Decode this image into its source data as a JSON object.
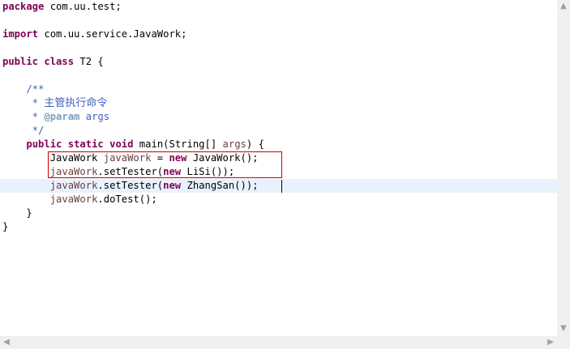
{
  "editor": {
    "lines": [
      [
        {
          "t": "package",
          "c": "kw"
        },
        {
          "t": " com.uu.test;",
          "c": ""
        }
      ],
      [],
      [
        {
          "t": "import",
          "c": "kw"
        },
        {
          "t": " com.uu.service.JavaWork;",
          "c": ""
        }
      ],
      [],
      [
        {
          "t": "public",
          "c": "kw"
        },
        {
          "t": " ",
          "c": ""
        },
        {
          "t": "class",
          "c": "kw"
        },
        {
          "t": " T2 {",
          "c": ""
        }
      ],
      [],
      [
        {
          "t": "    /**",
          "c": "cm"
        }
      ],
      [
        {
          "t": "     * ",
          "c": "cm"
        },
        {
          "t": "主管执行命令",
          "c": "cn"
        }
      ],
      [
        {
          "t": "     * ",
          "c": "cm"
        },
        {
          "t": "@param",
          "c": "tag"
        },
        {
          "t": " args",
          "c": "cm"
        }
      ],
      [
        {
          "t": "     */",
          "c": "cm"
        }
      ],
      [
        {
          "t": "    ",
          "c": ""
        },
        {
          "t": "public",
          "c": "kw"
        },
        {
          "t": " ",
          "c": ""
        },
        {
          "t": "static",
          "c": "kw"
        },
        {
          "t": " ",
          "c": ""
        },
        {
          "t": "void",
          "c": "kw"
        },
        {
          "t": " main(String[] ",
          "c": ""
        },
        {
          "t": "args",
          "c": "var"
        },
        {
          "t": ") {",
          "c": ""
        }
      ],
      [
        {
          "t": "        JavaWork ",
          "c": ""
        },
        {
          "t": "javaWork",
          "c": "var"
        },
        {
          "t": " = ",
          "c": ""
        },
        {
          "t": "new",
          "c": "kw"
        },
        {
          "t": " JavaWork();",
          "c": ""
        }
      ],
      [
        {
          "t": "        ",
          "c": ""
        },
        {
          "t": "javaWork",
          "c": "var"
        },
        {
          "t": ".setTester(",
          "c": ""
        },
        {
          "t": "new",
          "c": "kw"
        },
        {
          "t": " LiSi());",
          "c": ""
        }
      ],
      [
        {
          "t": "        ",
          "c": ""
        },
        {
          "t": "javaWork",
          "c": "var"
        },
        {
          "t": ".setTester(",
          "c": ""
        },
        {
          "t": "new",
          "c": "kw"
        },
        {
          "t": " ZhangSan());",
          "c": ""
        }
      ],
      [
        {
          "t": "        ",
          "c": ""
        },
        {
          "t": "javaWork",
          "c": "var"
        },
        {
          "t": ".doTest();",
          "c": ""
        }
      ],
      [
        {
          "t": "    }",
          "c": ""
        }
      ],
      [
        {
          "t": "}",
          "c": ""
        }
      ]
    ],
    "current_line_index": 13
  },
  "scrollbars": {
    "up_arrow": "▲",
    "down_arrow": "▼",
    "left_arrow": "◀",
    "right_arrow": "▶"
  }
}
